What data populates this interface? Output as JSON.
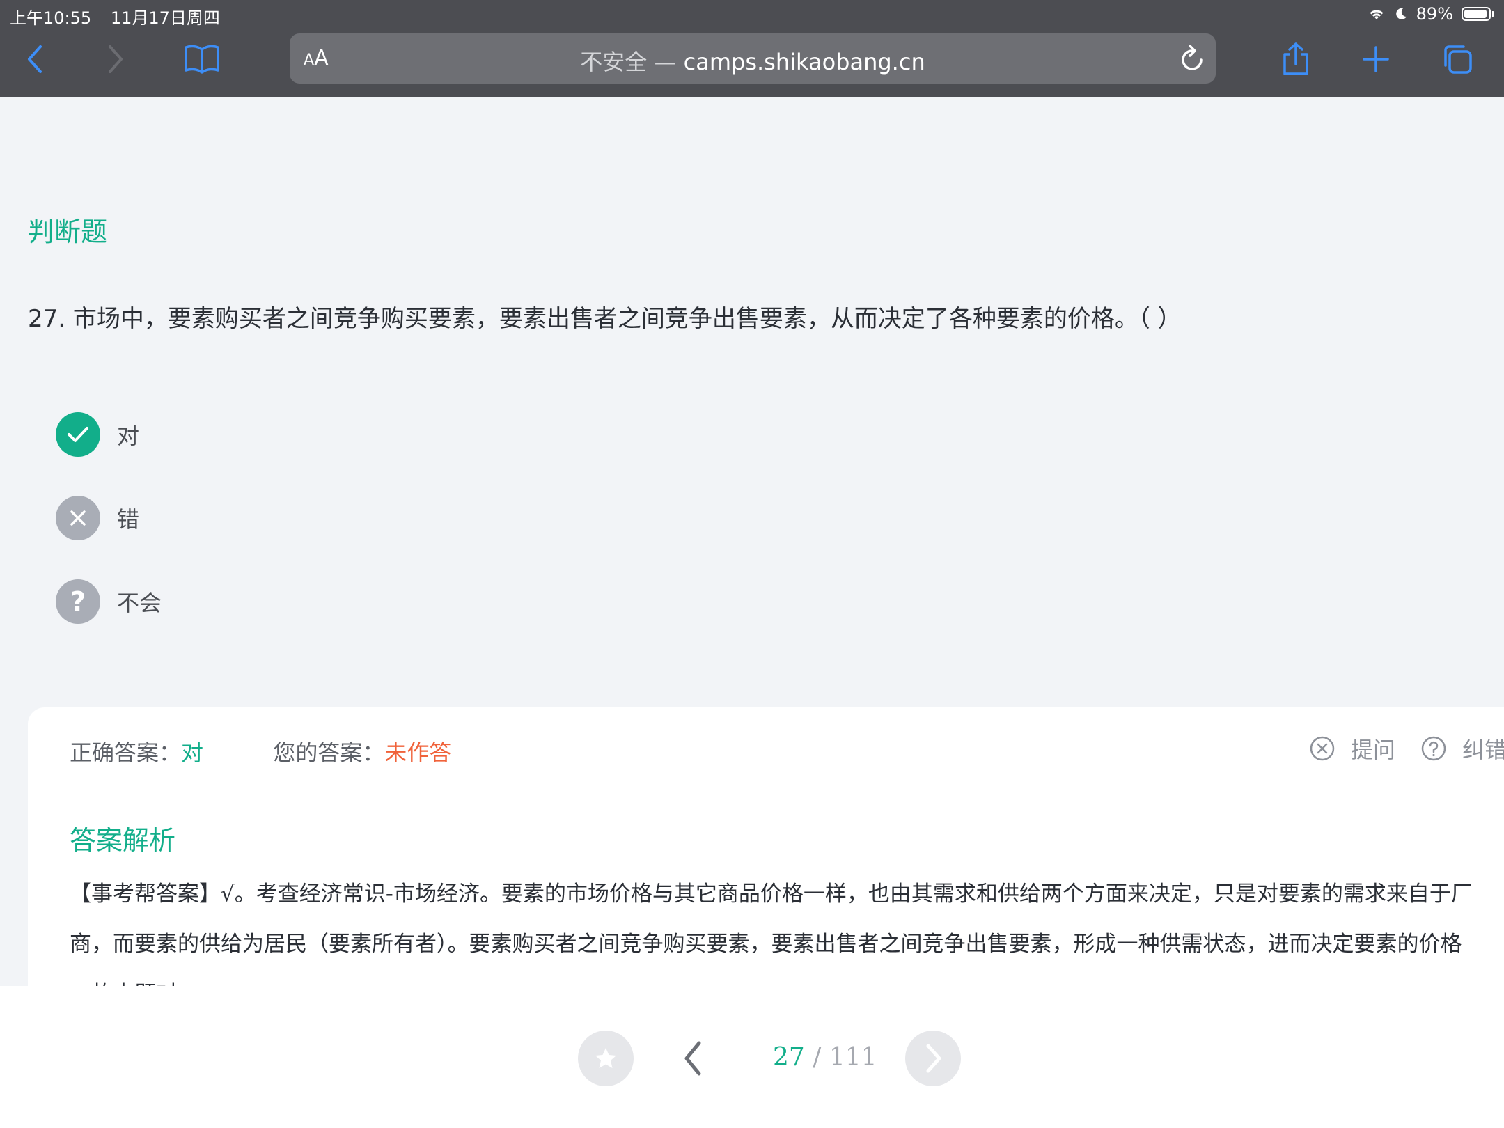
{
  "status_bar": {
    "time": "上午10:55",
    "date": "11月17日周四",
    "battery": "89%"
  },
  "browser": {
    "aa_label_small": "A",
    "aa_label_big": "A",
    "url_prefix": "不安全 — ",
    "url": "camps.shikaobang.cn"
  },
  "question": {
    "type": "判断题",
    "text": "27. 市场中，要素购买者之间竞争购买要素，要素出售者之间竞争出售要素，从而决定了各种要素的价格。（ ）",
    "options": [
      {
        "label": "对",
        "icon": "check-icon",
        "state": "correct"
      },
      {
        "label": "错",
        "icon": "close-icon",
        "state": "neutral"
      },
      {
        "label": "不会",
        "icon": "question-icon",
        "state": "neutral"
      }
    ]
  },
  "answer": {
    "correct_label": "正确答案：",
    "correct_value": "对",
    "yours_label": "您的答案：",
    "yours_value": "未作答",
    "ask_label": "提问",
    "report_label": "纠错",
    "analysis_title": "答案解析",
    "analysis_line1": "【事考帮答案】√。考查经济常识-市场经济。要素的市场价格与其它商品价格一样，也由其需求和供给两个方面来决定，只是对要素的需求来自于厂",
    "analysis_line2": "商，而要素的供给为居民（要素所有者）。要素购买者之间竞争购买要素，要素出售者之间竞争出售要素，形成一种供需状态，进而决定要素的价格",
    "analysis_line3": "。故本题对"
  },
  "pager": {
    "current": "27",
    "separator": " / ",
    "total": "111"
  },
  "colors": {
    "accent_green": "#12ae8a",
    "unanswered_orange": "#f0623a",
    "chrome_dark": "#4c4d52"
  }
}
